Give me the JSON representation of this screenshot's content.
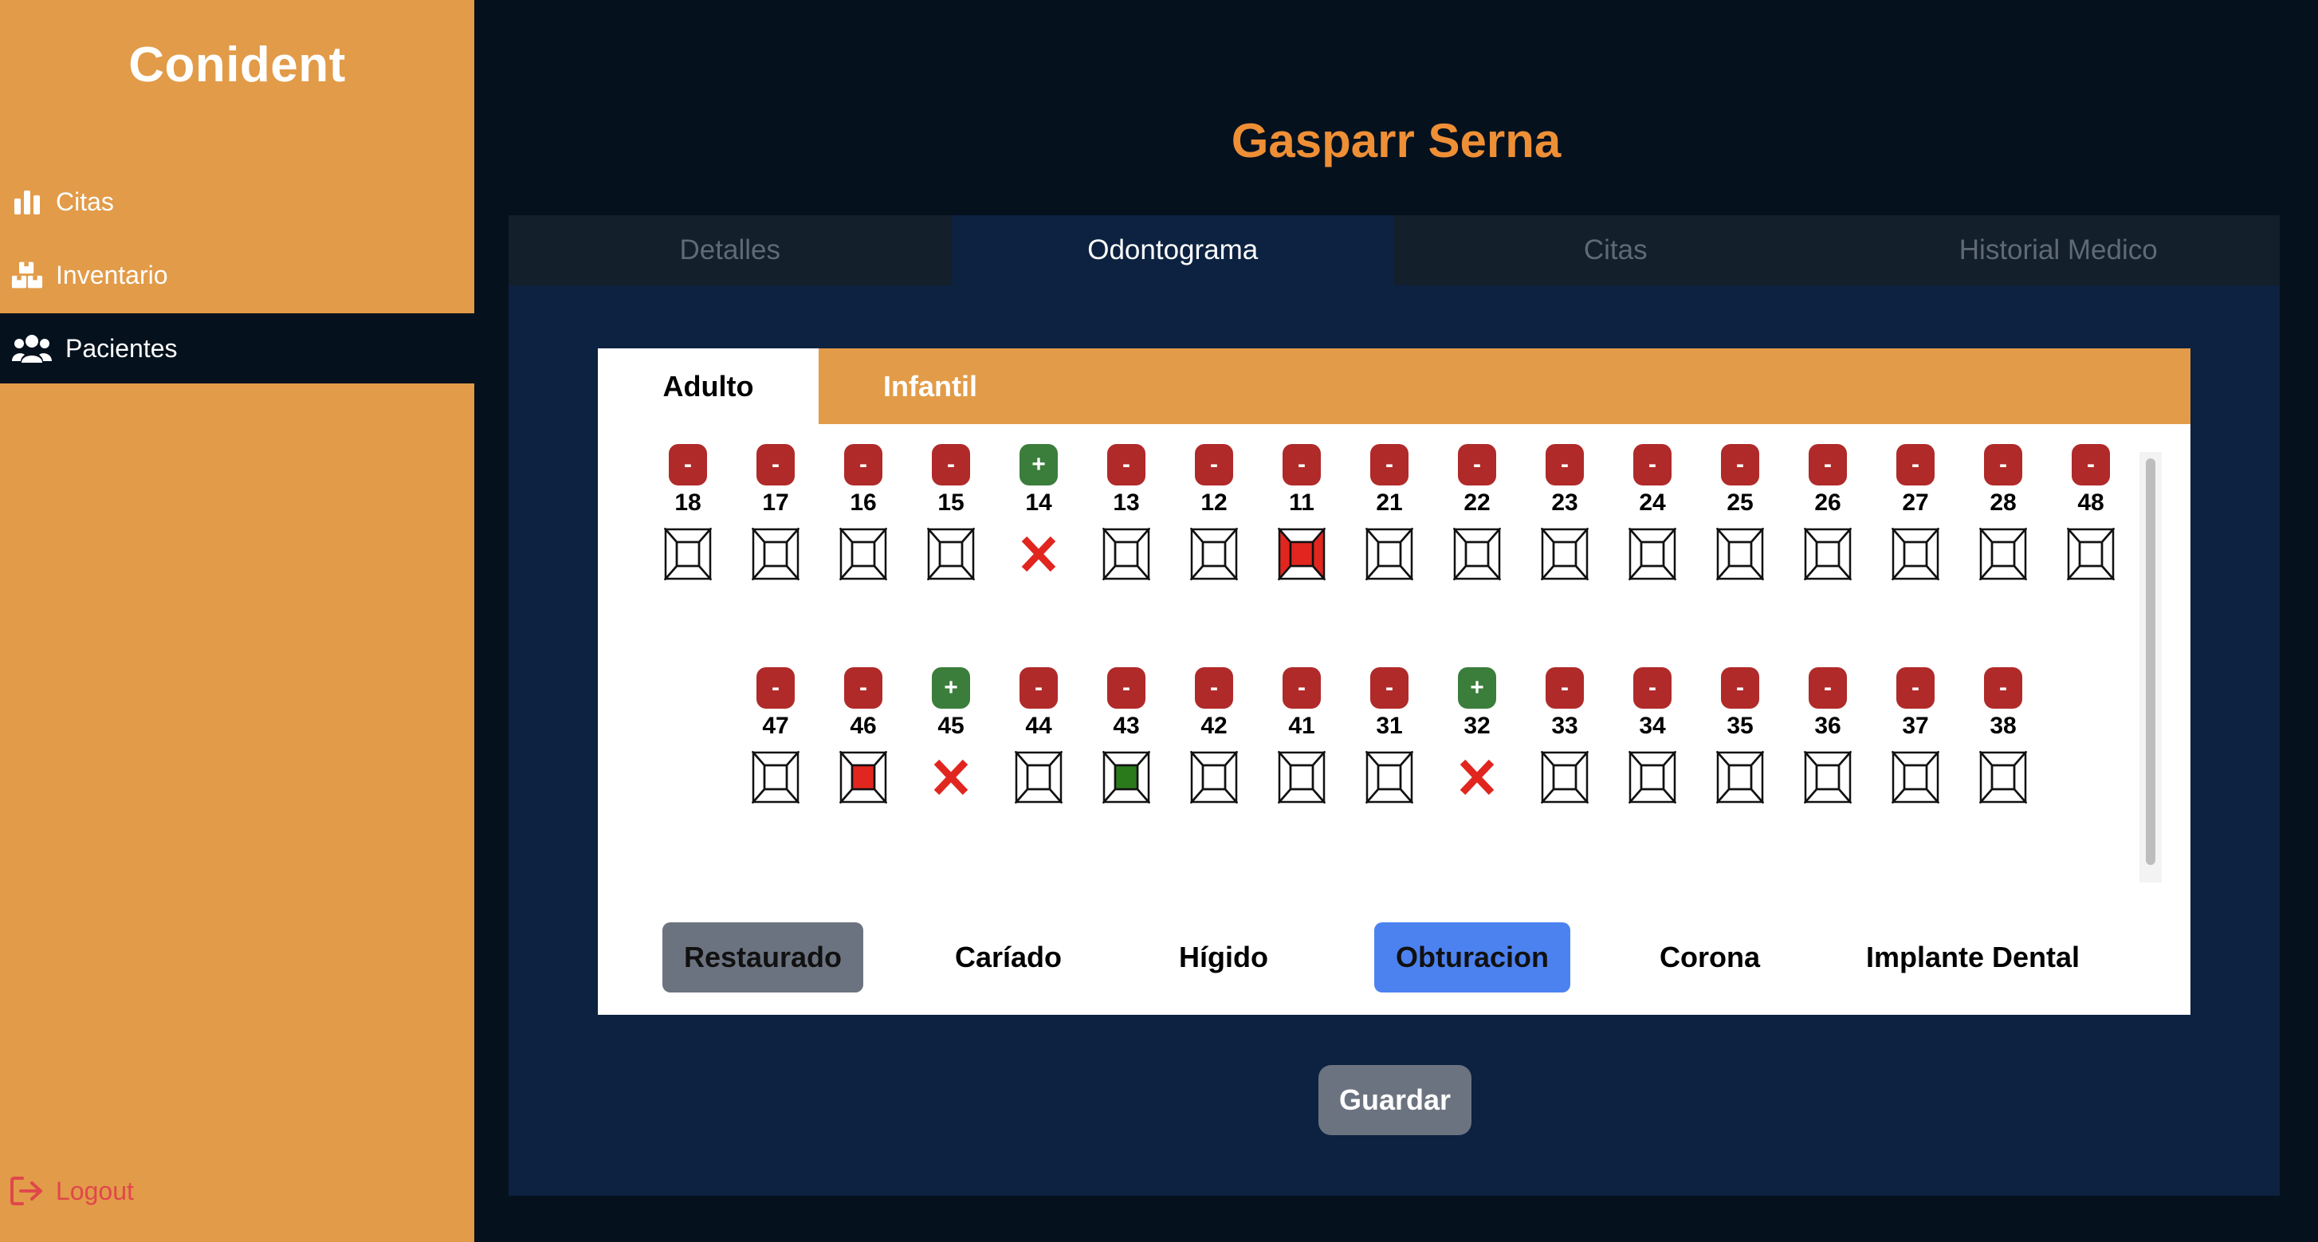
{
  "app": {
    "brand": "Conident"
  },
  "sidebar": {
    "items": [
      {
        "label": "Citas",
        "icon": "bar-chart-icon"
      },
      {
        "label": "Inventario",
        "icon": "boxes-icon"
      },
      {
        "label": "Pacientes",
        "icon": "users-icon",
        "active": true
      }
    ],
    "logout_label": "Logout"
  },
  "patient": {
    "name": "Gasparr Serna"
  },
  "tabs": [
    {
      "label": "Detalles"
    },
    {
      "label": "Odontograma",
      "active": true
    },
    {
      "label": "Citas"
    },
    {
      "label": "Historial Medico"
    }
  ],
  "subtabs": [
    {
      "label": "Adulto",
      "active": true
    },
    {
      "label": "Infantil"
    }
  ],
  "odontogram": {
    "upper": [
      {
        "num": "18",
        "btn": "-",
        "state": "normal"
      },
      {
        "num": "17",
        "btn": "-",
        "state": "normal"
      },
      {
        "num": "16",
        "btn": "-",
        "state": "normal"
      },
      {
        "num": "15",
        "btn": "-",
        "state": "normal"
      },
      {
        "num": "14",
        "btn": "+",
        "state": "missing"
      },
      {
        "num": "13",
        "btn": "-",
        "state": "normal"
      },
      {
        "num": "12",
        "btn": "-",
        "state": "normal"
      },
      {
        "num": "11",
        "btn": "-",
        "state": "red-left-right"
      },
      {
        "num": "21",
        "btn": "-",
        "state": "normal"
      },
      {
        "num": "22",
        "btn": "-",
        "state": "normal"
      },
      {
        "num": "23",
        "btn": "-",
        "state": "normal"
      },
      {
        "num": "24",
        "btn": "-",
        "state": "normal"
      },
      {
        "num": "25",
        "btn": "-",
        "state": "normal"
      },
      {
        "num": "26",
        "btn": "-",
        "state": "normal"
      },
      {
        "num": "27",
        "btn": "-",
        "state": "normal"
      },
      {
        "num": "28",
        "btn": "-",
        "state": "normal"
      },
      {
        "num": "48",
        "btn": "-",
        "state": "normal"
      }
    ],
    "lower": [
      {
        "num": "47",
        "btn": "-",
        "state": "normal"
      },
      {
        "num": "46",
        "btn": "-",
        "state": "red-center"
      },
      {
        "num": "45",
        "btn": "+",
        "state": "missing"
      },
      {
        "num": "44",
        "btn": "-",
        "state": "normal"
      },
      {
        "num": "43",
        "btn": "-",
        "state": "green-center"
      },
      {
        "num": "42",
        "btn": "-",
        "state": "normal"
      },
      {
        "num": "41",
        "btn": "-",
        "state": "normal"
      },
      {
        "num": "31",
        "btn": "-",
        "state": "normal"
      },
      {
        "num": "32",
        "btn": "+",
        "state": "missing"
      },
      {
        "num": "33",
        "btn": "-",
        "state": "normal"
      },
      {
        "num": "34",
        "btn": "-",
        "state": "normal"
      },
      {
        "num": "35",
        "btn": "-",
        "state": "normal"
      },
      {
        "num": "36",
        "btn": "-",
        "state": "normal"
      },
      {
        "num": "37",
        "btn": "-",
        "state": "normal"
      },
      {
        "num": "38",
        "btn": "-",
        "state": "normal"
      }
    ]
  },
  "legend": [
    {
      "label": "Restaurado",
      "style": "gray"
    },
    {
      "label": "Caríado",
      "style": "plain"
    },
    {
      "label": "Hígido",
      "style": "plain"
    },
    {
      "label": "Obturacion",
      "style": "blue"
    },
    {
      "label": "Corona",
      "style": "plain"
    },
    {
      "label": "Implante Dental",
      "style": "plain"
    }
  ],
  "actions": {
    "save_label": "Guardar"
  },
  "colors": {
    "sidebar": "#e29b48",
    "background": "#06111e",
    "panel": "#0c2240",
    "accent_name": "#ee8f36",
    "minus_button": "#b02a2a",
    "plus_button": "#3b7d3b",
    "caries_red": "#e0261f",
    "restored_green": "#2a7a1c",
    "obturacion_blue": "#4c82f0",
    "logout": "#e0474c"
  }
}
